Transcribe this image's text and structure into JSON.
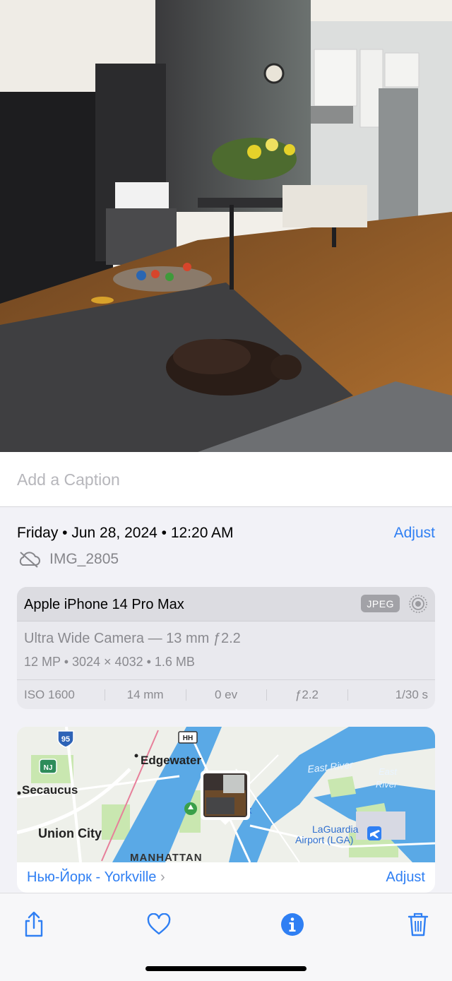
{
  "caption": {
    "placeholder": "Add a Caption"
  },
  "info": {
    "date_line": "Friday • Jun 28, 2024 • 12:20 AM",
    "adjust_label": "Adjust",
    "filename": "IMG_2805",
    "cloud_icon": "cloud-slash-icon"
  },
  "camera": {
    "device": "Apple iPhone 14 Pro Max",
    "format_badge": "JPEG",
    "live_icon": "live-photo-icon",
    "lens": "Ultra Wide Camera — 13 mm ƒ2.2",
    "specs": "12 MP  •  3024 × 4032  •  1.6 MB",
    "exif": [
      "ISO 1600",
      "14 mm",
      "0 ev",
      "ƒ2.2",
      "1/30 s"
    ]
  },
  "map": {
    "labels": {
      "edgewater": "Edgewater",
      "secaucus": "Secaucus",
      "union_city": "Union City",
      "manhattan": "MANHATTAN",
      "east_river": "East River",
      "east_river2": "East",
      "east_river3": "River",
      "laguardia1": "LaGuardia",
      "laguardia2": "Airport (LGA)",
      "shield_95": "95",
      "shield_nj": "NJ",
      "shield_hh": "HH",
      "york_fragment": "rk"
    },
    "location_label": "Нью-Йорк - Yorkville",
    "adjust_label": "Adjust"
  },
  "toolbar": {
    "icons": [
      "share-icon",
      "heart-icon",
      "info-icon",
      "trash-icon"
    ]
  },
  "colors": {
    "accent": "#2f7ff3",
    "secondary_text": "#86868b",
    "background": "#f2f2f7"
  }
}
